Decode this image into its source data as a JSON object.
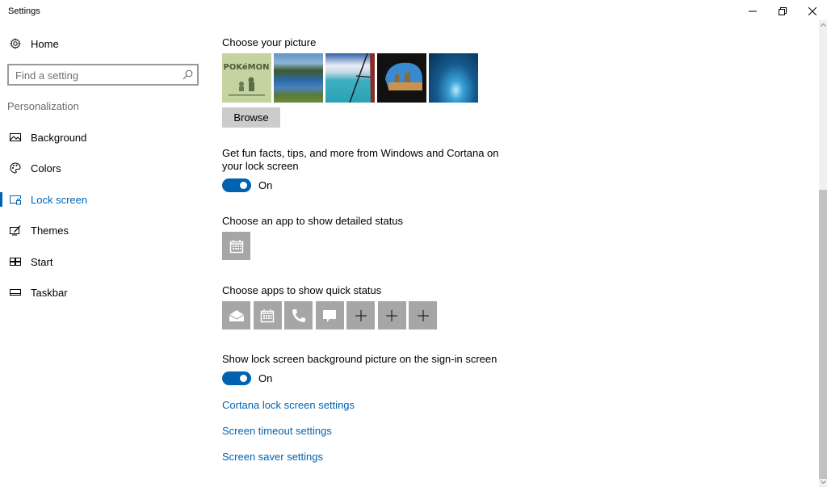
{
  "window": {
    "title": "Settings",
    "controls": {
      "minimize": "minimize-icon",
      "maximize": "restore-icon",
      "close": "close-icon"
    }
  },
  "sidebar": {
    "home": {
      "label": "Home",
      "icon": "gear-icon"
    },
    "search": {
      "placeholder": "Find a setting",
      "value": "",
      "icon": "search-icon"
    },
    "section": "Personalization",
    "items": [
      {
        "label": "Background",
        "icon": "picture-icon",
        "active": false
      },
      {
        "label": "Colors",
        "icon": "palette-icon",
        "active": false
      },
      {
        "label": "Lock screen",
        "icon": "lock-screen-icon",
        "active": true
      },
      {
        "label": "Themes",
        "icon": "themes-icon",
        "active": false
      },
      {
        "label": "Start",
        "icon": "start-icon",
        "active": false
      },
      {
        "label": "Taskbar",
        "icon": "taskbar-icon",
        "active": false
      }
    ]
  },
  "main": {
    "picture": {
      "heading": "Choose your picture",
      "thumbnails": [
        {
          "name": "pokemon-gameboy",
          "colors": [
            "#c4d4a0",
            "#5a6b48"
          ]
        },
        {
          "name": "mountain-lake",
          "colors": [
            "#3b7bb5",
            "#4d6a32"
          ]
        },
        {
          "name": "sea-from-plane",
          "colors": [
            "#3ab2c2",
            "#e8eef2"
          ]
        },
        {
          "name": "beach-cave",
          "colors": [
            "#111111",
            "#c8934e"
          ]
        },
        {
          "name": "ice-cave",
          "colors": [
            "#0b3a66",
            "#37a6d9"
          ]
        }
      ],
      "browse_label": "Browse"
    },
    "fun_facts": {
      "label": "Get fun facts, tips, and more from Windows and Cortana on your lock screen",
      "state": "On",
      "enabled": true
    },
    "detailed_status": {
      "heading": "Choose an app to show detailed status",
      "app_icon": "calendar-icon"
    },
    "quick_status": {
      "heading": "Choose apps to show quick status",
      "apps": [
        {
          "icon": "mail-icon"
        },
        {
          "icon": "calendar-icon"
        },
        {
          "icon": "phone-icon"
        },
        {
          "icon": "message-icon"
        },
        {
          "icon": "plus-icon"
        },
        {
          "icon": "plus-icon"
        },
        {
          "icon": "plus-icon"
        }
      ]
    },
    "signin_bg": {
      "label": "Show lock screen background picture on the sign-in screen",
      "state": "On",
      "enabled": true
    },
    "links": [
      "Cortana lock screen settings",
      "Screen timeout settings",
      "Screen saver settings"
    ]
  },
  "colors": {
    "accent": "#0063b1",
    "tile": "#a6a6a6",
    "button": "#cccccc"
  },
  "scroll": {
    "position_fraction": 0.37,
    "visible_fraction": 0.62
  }
}
